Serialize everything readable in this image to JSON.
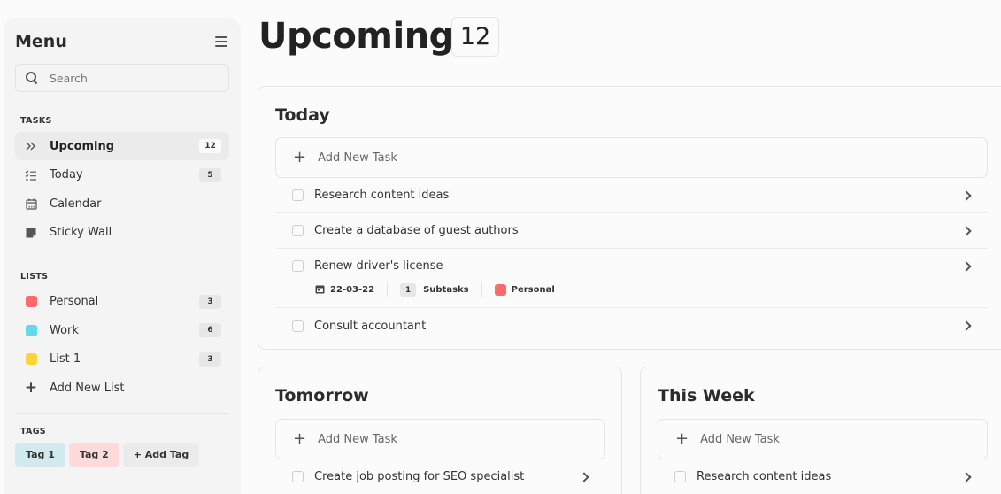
{
  "sidebar": {
    "title": "Menu",
    "search_placeholder": "Search",
    "tasks_label": "TASKS",
    "tasks": [
      {
        "label": "Upcoming",
        "count": "12",
        "icon": "double-chevron-right-icon"
      },
      {
        "label": "Today",
        "count": "5",
        "icon": "checklist-icon"
      },
      {
        "label": "Calendar",
        "icon": "calendar-icon"
      },
      {
        "label": "Sticky Wall",
        "icon": "sticky-note-icon"
      }
    ],
    "lists_label": "LISTS",
    "lists": [
      {
        "label": "Personal",
        "count": "3",
        "color": "#ff6b6b"
      },
      {
        "label": "Work",
        "count": "6",
        "color": "#66d9e8"
      },
      {
        "label": "List 1",
        "count": "3",
        "color": "#ffd43b"
      }
    ],
    "add_list_label": "Add New List",
    "tags_label": "TAGS",
    "tags": [
      {
        "label": "Tag 1",
        "color": "#d1eaed"
      },
      {
        "label": "Tag 2",
        "color": "#ffdada"
      }
    ],
    "add_tag_label": "+ Add Tag"
  },
  "main": {
    "title": "Upcoming",
    "count": "12",
    "today": {
      "title": "Today",
      "add_label": "Add New Task",
      "tasks": [
        {
          "label": "Research content ideas"
        },
        {
          "label": "Create a database of guest authors"
        },
        {
          "label": "Renew driver's license",
          "date": "22-03-22",
          "subtasks_count": "1",
          "subtasks_label": "Subtasks",
          "list": "Personal",
          "list_color": "#ff6b6b"
        },
        {
          "label": "Consult accountant"
        }
      ]
    },
    "tomorrow": {
      "title": "Tomorrow",
      "add_label": "Add New Task",
      "tasks": [
        {
          "label": "Create job posting for SEO specialist"
        }
      ]
    },
    "this_week": {
      "title": "This Week",
      "add_label": "Add New Task",
      "tasks": [
        {
          "label": "Research content ideas"
        }
      ]
    }
  }
}
